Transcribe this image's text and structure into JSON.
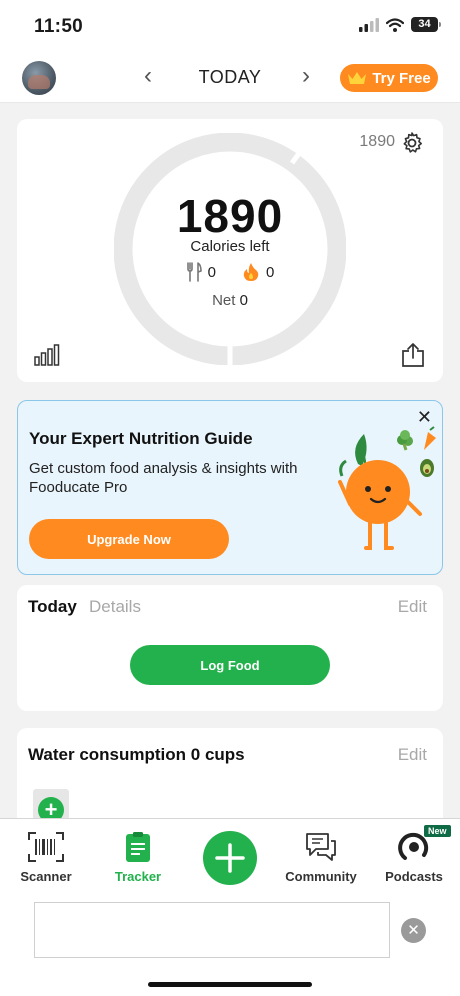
{
  "status": {
    "time": "11:50",
    "battery": "34"
  },
  "nav": {
    "title": "TODAY",
    "try_free": "Try Free"
  },
  "calories": {
    "budget": "1890",
    "remaining": "1890",
    "label": "Calories left",
    "food": "0",
    "exercise": "0",
    "net_label": "Net",
    "net": "0",
    "ring_progress": 0
  },
  "promo": {
    "title": "Your Expert Nutrition Guide",
    "text": "Get custom food analysis & insights with Fooducate Pro",
    "button": "Upgrade Now",
    "close": "✕"
  },
  "today": {
    "title": "Today",
    "details": "Details",
    "edit": "Edit",
    "log_food": "Log Food"
  },
  "water": {
    "title": "Water consumption 0 cups",
    "edit": "Edit"
  },
  "tabs": [
    {
      "label": "Scanner"
    },
    {
      "label": "Tracker"
    },
    {
      "label": "Community"
    },
    {
      "label": "Podcasts",
      "badge": "New"
    }
  ],
  "colors": {
    "brand_green": "#22b14c",
    "accent_orange": "#ff8a1f",
    "promo_bg": "#e9f5fc"
  },
  "icons": [
    "avatar",
    "chevron-left-icon",
    "chevron-right-icon",
    "crown-icon",
    "gear-icon",
    "fork-knife-icon",
    "flame-icon",
    "bar-chart-icon",
    "share-icon",
    "close-icon",
    "barcode-icon",
    "clipboard-icon",
    "plus-icon",
    "chat-icon",
    "podcast-icon"
  ]
}
